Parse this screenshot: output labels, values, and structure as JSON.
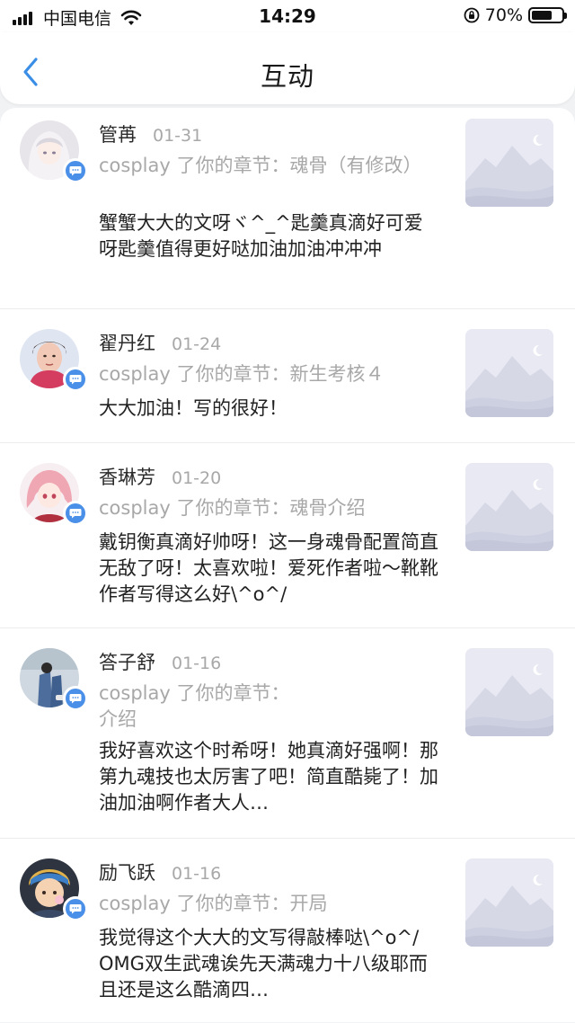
{
  "status_bar": {
    "carrier": "中国电信",
    "time": "14:29",
    "battery_percent": "70%",
    "battery_level": 0.7
  },
  "nav": {
    "title": "互动",
    "back_icon": "chevron-left-icon"
  },
  "colors": {
    "badge": "#4a8fe8",
    "back_arrow": "#3a8ee6",
    "muted_text": "#a8a8a8"
  },
  "items": [
    {
      "username": "管苒",
      "date": "01-31",
      "action": "cosplay 了你的章节：魂骨（有修改）",
      "comment": "蟹蟹大大的文呀ヾ^_^匙羹真滴好可爱呀匙羹值得更好哒加油加油冲冲冲"
    },
    {
      "username": "翟丹红",
      "date": "01-24",
      "action": "cosplay 了你的章节：新生考核４",
      "comment": "大大加油！写的很好！"
    },
    {
      "username": "香琳芳",
      "date": "01-20",
      "action": "cosplay 了你的章节：魂骨介绍",
      "comment": "戴钥衡真滴好帅呀！这一身魂骨配置简直无敌了呀！太喜欢啦！爱死作者啦～靴靴作者写得这么好\\^o^/"
    },
    {
      "username": "答子舒",
      "date": "01-16",
      "action": "cosplay 了你的章节：\n介绍",
      "comment": "我好喜欢这个时希呀！她真滴好强啊！那第九魂技也太厉害了吧！简直酷毙了！加油加油啊作者大人…"
    },
    {
      "username": "励飞跃",
      "date": "01-16",
      "action": "cosplay 了你的章节：开局",
      "comment": "我觉得这个大大的文写得敲棒哒\\^o^/　OMG双生武魂诶先天满魂力十八级耶而且还是这么酷滴四…"
    }
  ]
}
